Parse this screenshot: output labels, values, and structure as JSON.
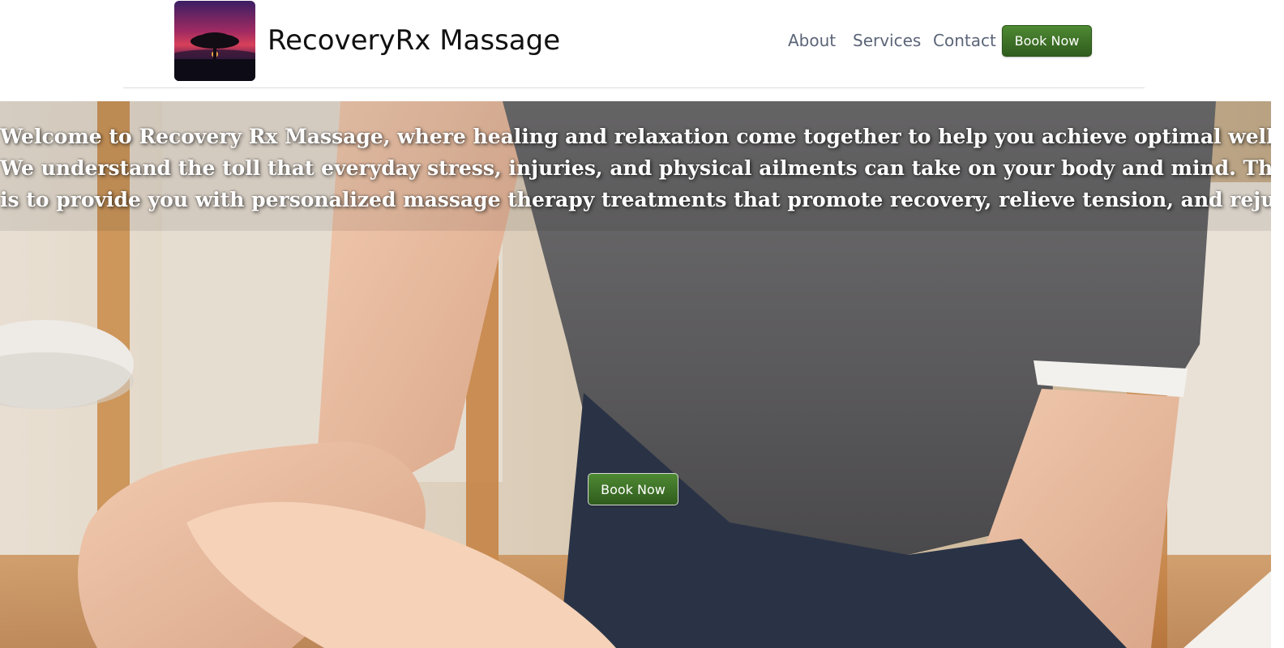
{
  "header": {
    "brand": "RecoveryRx Massage",
    "logo_icon": "tree-sunset-logo",
    "nav": [
      {
        "label": "About"
      },
      {
        "label": "Services"
      },
      {
        "label": "Contact"
      }
    ],
    "book_label": "Book Now"
  },
  "hero": {
    "line1": "Welcome to Recovery Rx Massage, where healing and relaxation come together to help you achieve optimal well-being.",
    "line2": "We understand the toll that everyday stress, injuries, and physical ailments can take on your body and mind. That's why our mission",
    "line3": "is to provide you with personalized massage therapy treatments that promote recovery, relieve tension, and rejuvenate your body.",
    "book_label": "Book Now",
    "image": "massage-therapist-wrist-photo"
  },
  "colors": {
    "button_green": "#3f7228",
    "nav_text": "#5b6478",
    "brand_text": "#111111"
  }
}
